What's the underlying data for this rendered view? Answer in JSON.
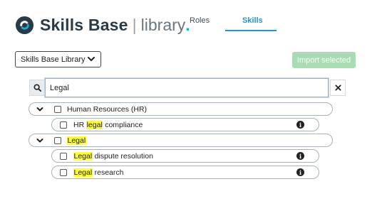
{
  "brand": {
    "name": "Skills Base",
    "separator": "|",
    "suffix": "library",
    "dot": "."
  },
  "nav": {
    "tabs": [
      {
        "label": "Roles",
        "active": false
      },
      {
        "label": "Skills",
        "active": true
      }
    ]
  },
  "toolbar": {
    "library_select": "Skills Base Library",
    "import_label": "Import selected"
  },
  "search": {
    "value": "Legal",
    "placeholder": ""
  },
  "tree": {
    "groups": [
      {
        "label": "Human Resources (HR)",
        "expanded": true,
        "items": [
          {
            "pre": "HR ",
            "match": "legal",
            "post": " compliance"
          }
        ]
      },
      {
        "label": "",
        "match": "Legal",
        "expanded": true,
        "items": [
          {
            "pre": "",
            "match": "Legal",
            "post": " dispute resolution"
          },
          {
            "pre": "",
            "match": "Legal",
            "post": " research"
          }
        ]
      }
    ]
  },
  "colors": {
    "accent": "#2196d6",
    "highlight": "#ffff33",
    "import_disabled": "#a9dcb3",
    "brand_dark": "#2a3b47"
  }
}
